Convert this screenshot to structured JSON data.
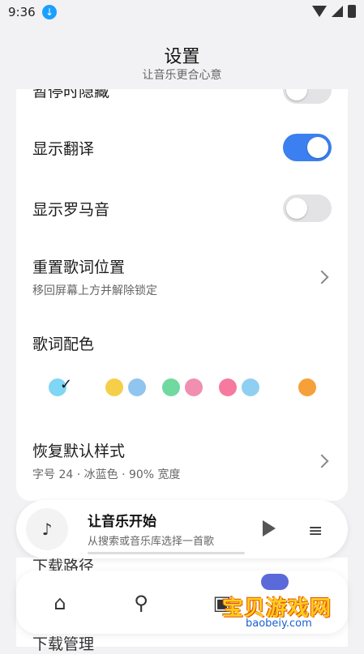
{
  "status_bar": {
    "time": "9:36"
  },
  "header": {
    "title": "设置",
    "subtitle": "让音乐更合心意"
  },
  "settings": {
    "partial_top": "暂停时隐藏",
    "show_translation": {
      "label": "显示翻译",
      "on": true
    },
    "show_romaji": {
      "label": "显示罗马音",
      "on": false
    },
    "reset_lyrics": {
      "label": "重置歌词位置",
      "sub": "移回屏幕上方并解除锁定"
    },
    "lyrics_color": {
      "label": "歌词配色"
    },
    "restore_default": {
      "label": "恢复默认样式",
      "sub": "字号 24 · 冰蓝色 · 90% 宽度"
    }
  },
  "color_swatches": [
    {
      "colors": [
        "#7fd6f5"
      ],
      "selected": true
    },
    {
      "colors": [
        "#f5cf4a",
        "#90c5f0"
      ],
      "selected": false
    },
    {
      "colors": [
        "#6fd9a0",
        "#f08fb0"
      ],
      "selected": false
    },
    {
      "colors": [
        "#f67aa0",
        "#8fd0f2"
      ],
      "selected": false
    },
    {
      "colors": [
        "#f6a03a"
      ],
      "selected": false
    }
  ],
  "mini_player": {
    "title": "让音乐开始",
    "subtitle": "从搜索或音乐库选择一首歌"
  },
  "background_rows": {
    "download_path": "下载路径",
    "download_manage": "下载管理"
  },
  "bottom_nav": {
    "items": [
      {
        "icon": "home-icon"
      },
      {
        "icon": "search-icon"
      },
      {
        "icon": "library-icon"
      }
    ]
  },
  "watermark": {
    "text": "宝贝游戏网",
    "url": "baobeiy.com"
  },
  "colors": {
    "accent": "#3b7ff0",
    "toggle_off": "#e3e3e5"
  }
}
